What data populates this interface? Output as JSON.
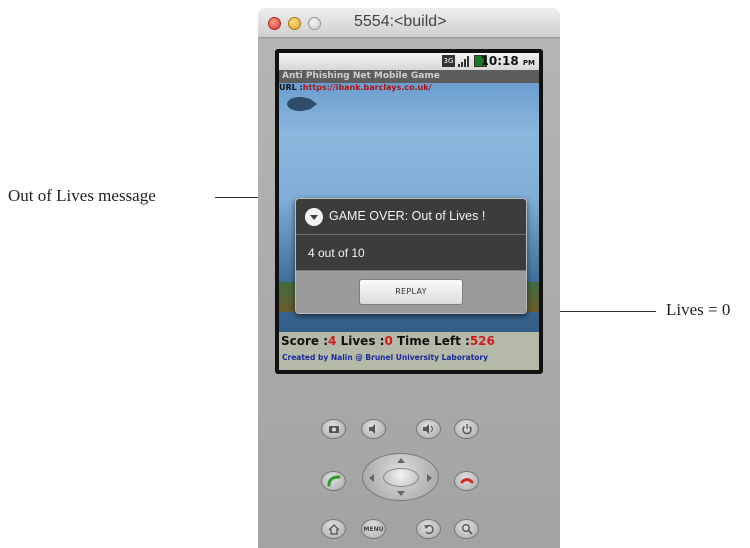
{
  "annotations": {
    "left_callout": "Out of Lives message",
    "right_callout": "Lives = 0"
  },
  "window": {
    "title": "5554:<build>"
  },
  "status_bar": {
    "time": "10:18",
    "ampm": "PM",
    "icons": [
      "3g-icon",
      "signal-icon",
      "battery-icon"
    ]
  },
  "app": {
    "title": "Anti Phishing Net Mobile Game",
    "url_label": "URL :",
    "url_value": "https://ibank.barclays.co.uk/"
  },
  "dialog": {
    "title": "GAME OVER: Out of Lives !",
    "message": "4  out of 10",
    "replay_label": "REPLAY"
  },
  "scoreboard": {
    "score_label": "Score :",
    "score_value": "4",
    "lives_label": "Lives :",
    "lives_value": "0",
    "time_label": "Time Left :",
    "time_value": "526"
  },
  "credits": "Created by Nalin @ Brunel University Laboratory",
  "hardware_buttons": {
    "menu_label": "MENU"
  },
  "colors": {
    "score_value": "#d21c1c",
    "url_value": "#b01010",
    "credits": "#1a2a9a"
  }
}
